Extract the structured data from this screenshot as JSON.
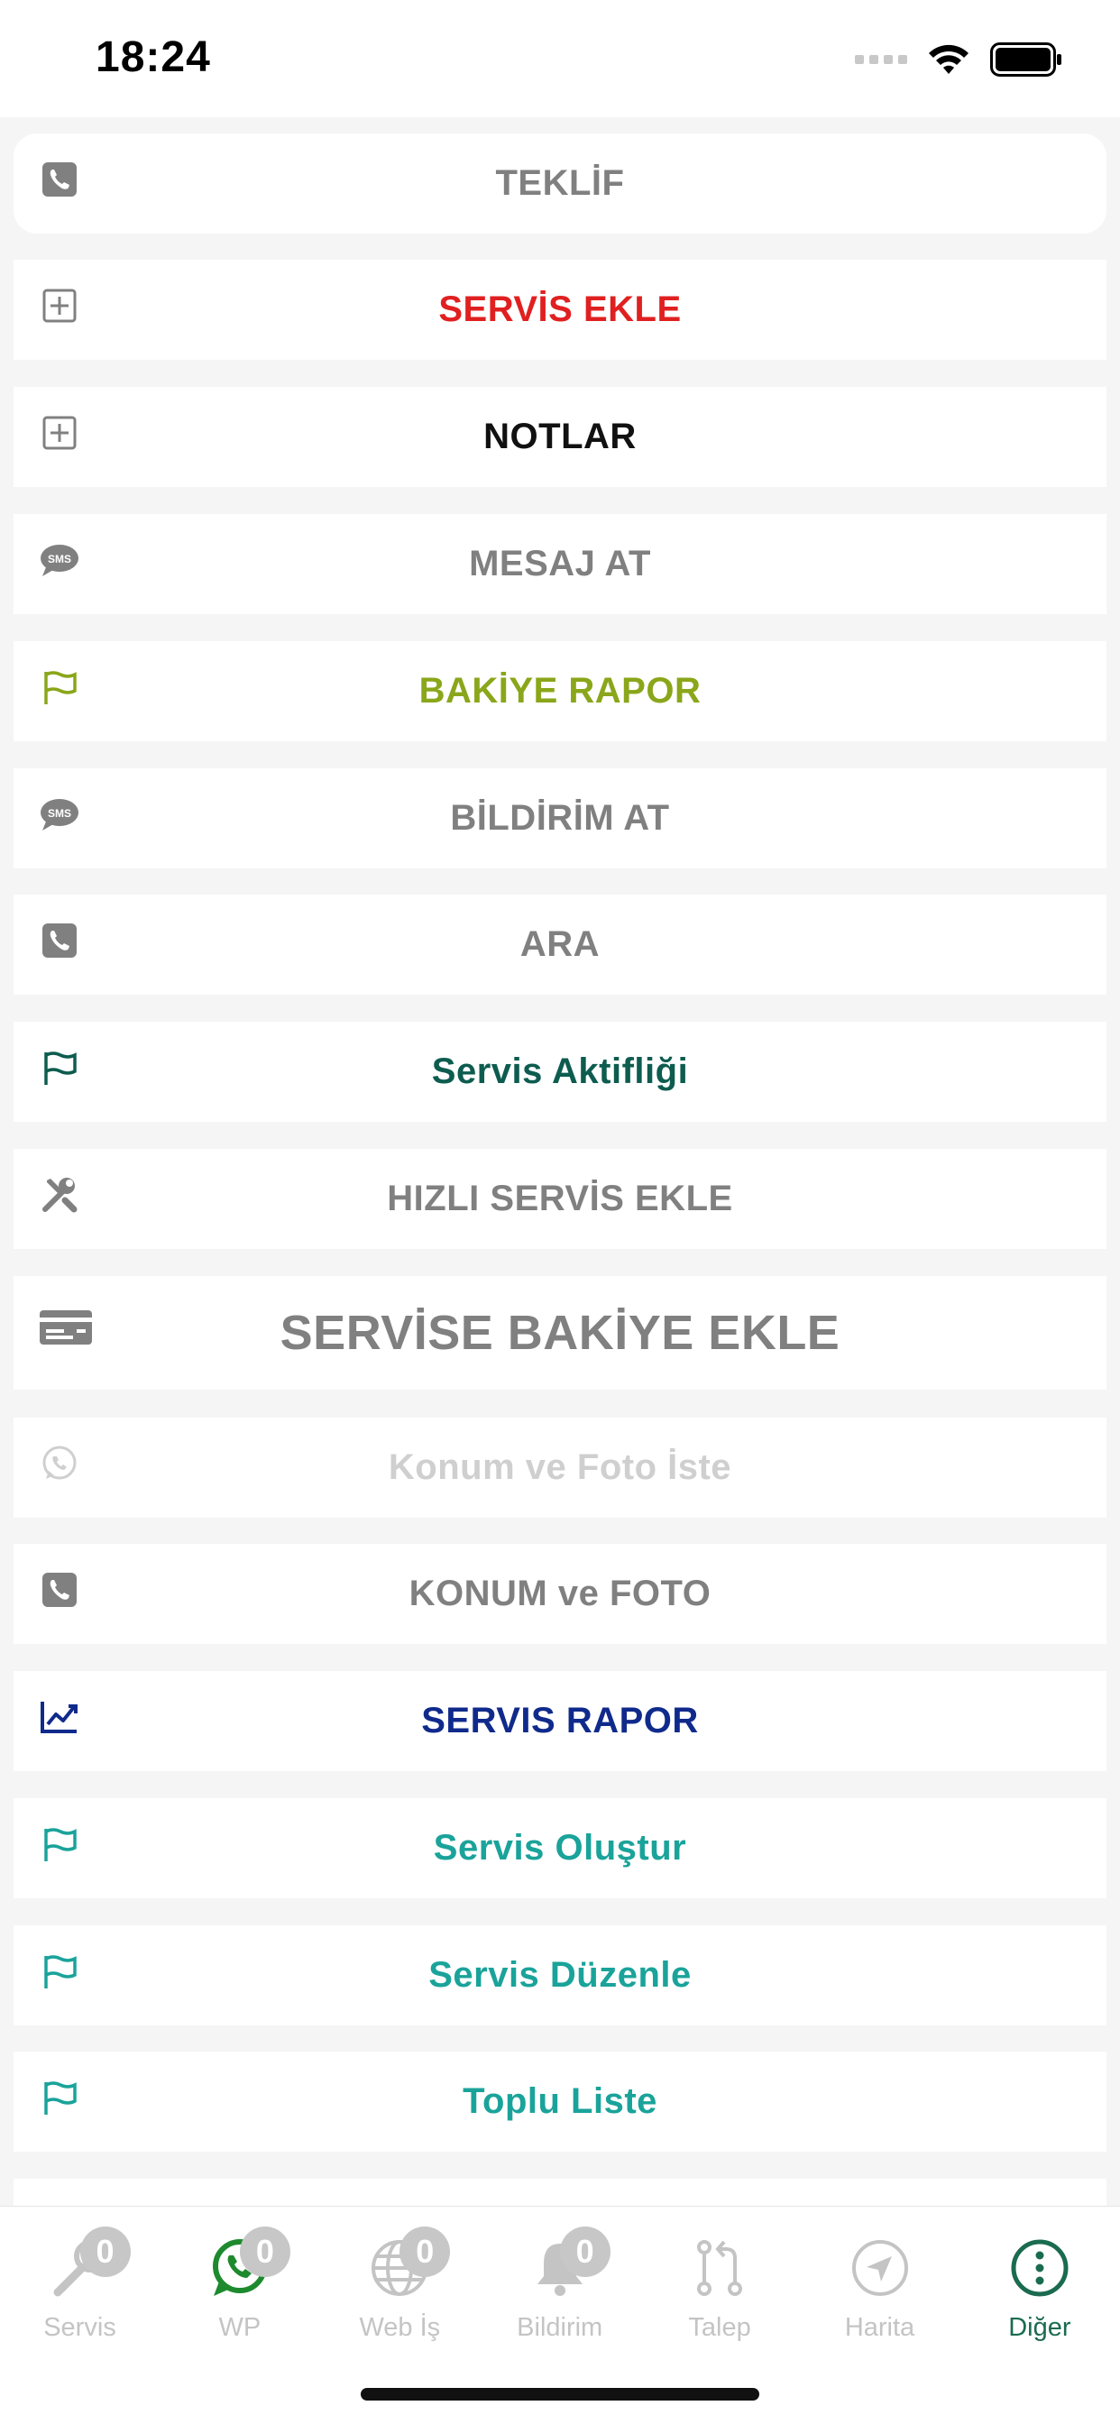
{
  "status_bar": {
    "time": "18:24"
  },
  "menu": {
    "items": [
      {
        "label": "TEKLİF",
        "icon": "phone-icon",
        "color": "#808080"
      },
      {
        "label": "SERVİS EKLE",
        "icon": "plus-square-icon",
        "color": "#e02020"
      },
      {
        "label": "NOTLAR",
        "icon": "plus-square-icon",
        "color": "#111111"
      },
      {
        "label": "MESAJ AT",
        "icon": "sms-icon",
        "color": "#808080"
      },
      {
        "label": "BAKİYE RAPOR",
        "icon": "flag-icon",
        "color": "#8aa61a"
      },
      {
        "label": "BİLDİRİM AT",
        "icon": "sms-icon",
        "color": "#808080"
      },
      {
        "label": "ARA",
        "icon": "phone-icon",
        "color": "#808080"
      },
      {
        "label": "Servis Aktifliği",
        "icon": "flag-icon",
        "color": "#0d5c4f"
      },
      {
        "label": "HIZLI SERVİS EKLE",
        "icon": "tools-icon",
        "color": "#808080"
      },
      {
        "label": "SERVİSE BAKİYE EKLE",
        "icon": "card-icon",
        "color": "#808080"
      },
      {
        "label": "Konum ve Foto İste",
        "icon": "whatsapp-icon",
        "color": "#cfcfcf"
      },
      {
        "label": "KONUM ve FOTO",
        "icon": "phone-icon",
        "color": "#808080"
      },
      {
        "label": "SERVIS RAPOR",
        "icon": "chart-icon",
        "color": "#102a8c"
      },
      {
        "label": "Servis Oluştur",
        "icon": "flag-icon",
        "color": "#1aa39a"
      },
      {
        "label": "Servis Düzenle",
        "icon": "flag-icon",
        "color": "#1aa39a"
      },
      {
        "label": "Toplu Liste",
        "icon": "flag-icon",
        "color": "#1aa39a"
      }
    ]
  },
  "tab_bar": {
    "tabs": [
      {
        "label": "Servis",
        "icon": "wrench-icon",
        "badge": "0",
        "active": false
      },
      {
        "label": "WP",
        "icon": "whatsapp-icon",
        "badge": "0",
        "active": false
      },
      {
        "label": "Web İş",
        "icon": "globe-icon",
        "badge": "0",
        "active": false
      },
      {
        "label": "Bildirim",
        "icon": "bell-icon",
        "badge": "0",
        "active": false
      },
      {
        "label": "Talep",
        "icon": "pull-request-icon",
        "badge": "",
        "active": false
      },
      {
        "label": "Harita",
        "icon": "navigation-icon",
        "badge": "",
        "active": false
      },
      {
        "label": "Diğer",
        "icon": "more-vertical-icon",
        "badge": "",
        "active": true
      }
    ],
    "active_color": "#1a6b4f",
    "inactive_color": "#c4c4c4",
    "wp_color": "#1d8a2e"
  }
}
